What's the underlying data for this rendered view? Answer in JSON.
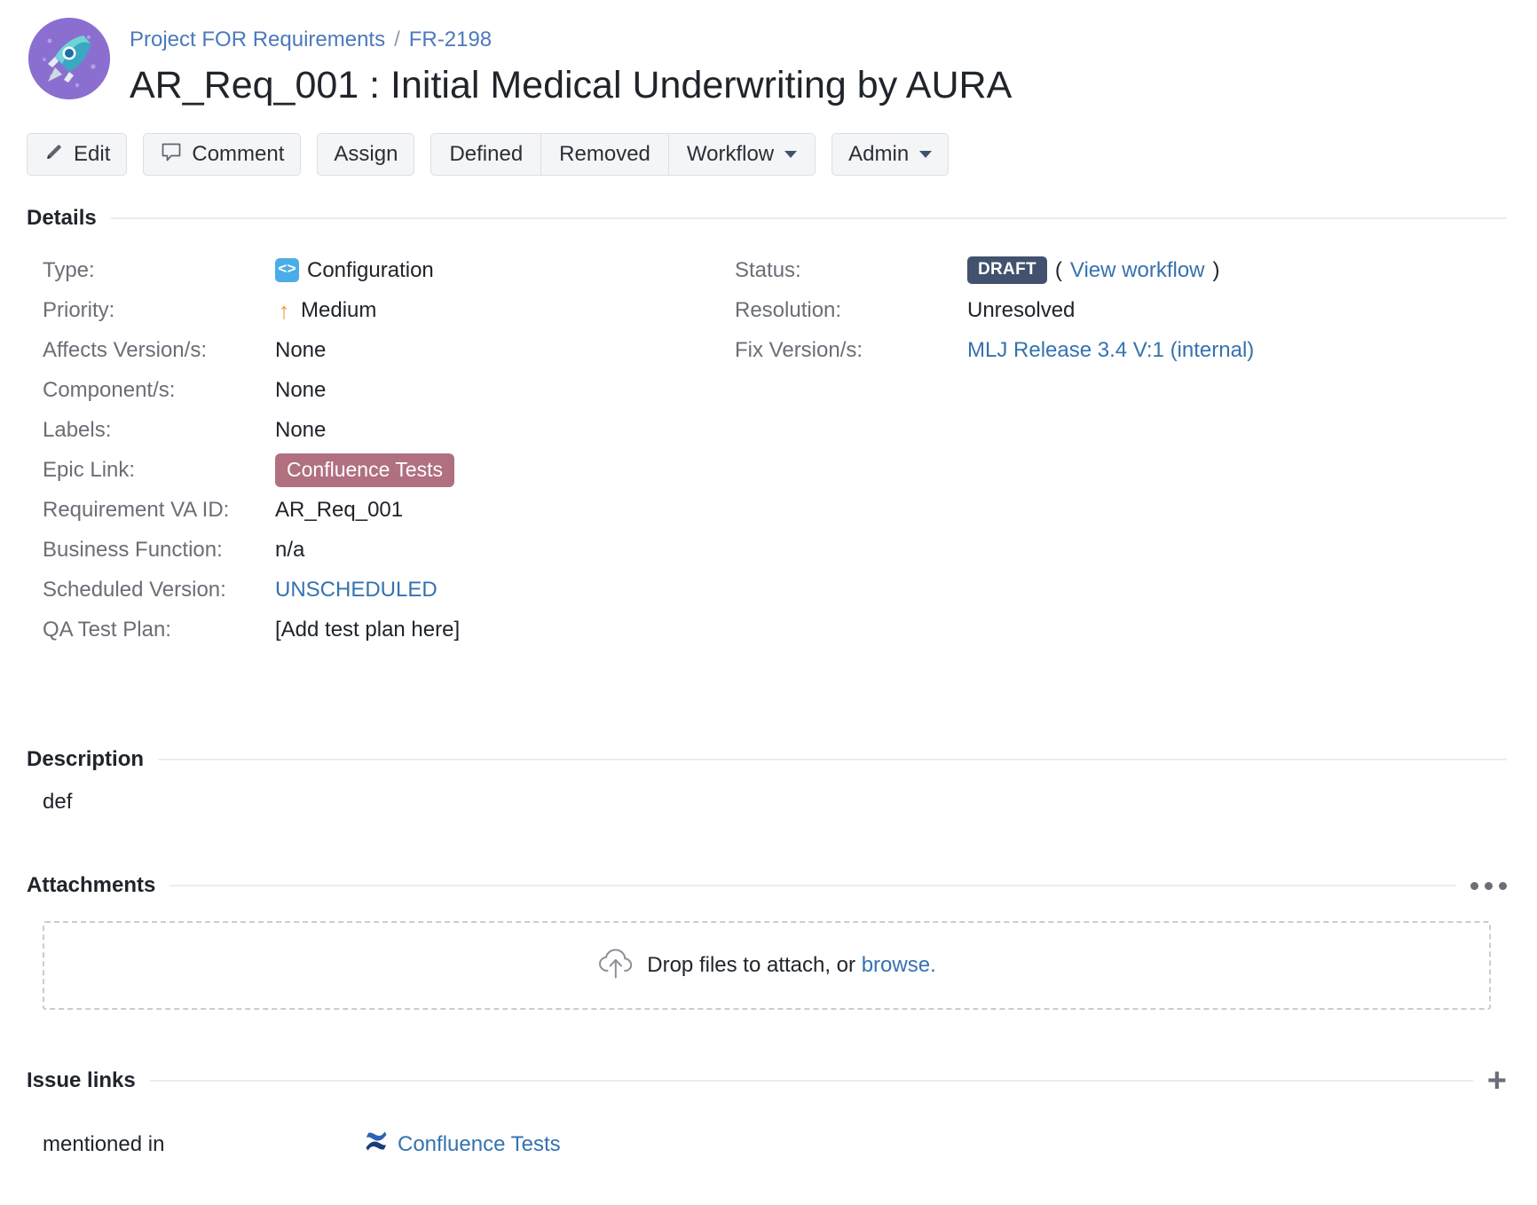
{
  "header": {
    "avatar_icon": "rocket-avatar-icon",
    "breadcrumb": {
      "project": "Project FOR Requirements",
      "separator": "/",
      "issue_key": "FR-2198"
    },
    "title": "AR_Req_001 : Initial Medical Underwriting by AURA"
  },
  "toolbar": {
    "edit_label": "Edit",
    "edit_icon": "pencil-icon",
    "comment_label": "Comment",
    "comment_icon": "speech-bubble-icon",
    "assign_label": "Assign",
    "group": {
      "defined_label": "Defined",
      "removed_label": "Removed",
      "workflow_label": "Workflow"
    },
    "admin_label": "Admin"
  },
  "details": {
    "heading": "Details",
    "left": [
      {
        "label": "Type:",
        "value": "Configuration",
        "icon": "configuration-type-icon"
      },
      {
        "label": "Priority:",
        "value": "Medium",
        "icon": "priority-medium-arrow-icon"
      },
      {
        "label": "Affects Version/s:",
        "value": "None"
      },
      {
        "label": "Component/s:",
        "value": "None"
      },
      {
        "label": "Labels:",
        "value": "None"
      },
      {
        "label": "Epic Link:",
        "value": "Confluence Tests",
        "style": "epic-lozenge"
      },
      {
        "label": "Requirement VA ID:",
        "value": "AR_Req_001"
      },
      {
        "label": "Business Function:",
        "value": "n/a"
      },
      {
        "label": "Scheduled Version:",
        "value": "UNSCHEDULED",
        "style": "link"
      },
      {
        "label": "QA Test Plan:",
        "value": "[Add test plan here]"
      }
    ],
    "right": {
      "status": {
        "label": "Status:",
        "badge": "DRAFT",
        "open_paren": "(",
        "workflow_link": "View workflow",
        "close_paren": ")"
      },
      "resolution": {
        "label": "Resolution:",
        "value": "Unresolved"
      },
      "fix_versions": {
        "label": "Fix Version/s:",
        "value": "MLJ Release 3.4 V:1 (internal)"
      }
    }
  },
  "description": {
    "heading": "Description",
    "body": "def"
  },
  "attachments": {
    "heading": "Attachments",
    "more_icon": "ellipsis-menu-icon",
    "dropzone": {
      "icon": "cloud-upload-icon",
      "text": "Drop files to attach, or",
      "browse_link": "browse."
    }
  },
  "issue_links": {
    "heading": "Issue links",
    "add_icon": "plus-icon",
    "rows": [
      {
        "type": "mentioned in",
        "icon": "confluence-icon",
        "target": "Confluence Tests"
      }
    ]
  },
  "colors": {
    "link": "#3572b0",
    "breadcrumb_link": "#4c79bd",
    "status_badge_bg": "#42526e",
    "epic_badge_bg": "#b07080",
    "type_icon_bg": "#4bade8",
    "priority_arrow": "#f79232",
    "avatar_bg": "#8b6fd0"
  }
}
